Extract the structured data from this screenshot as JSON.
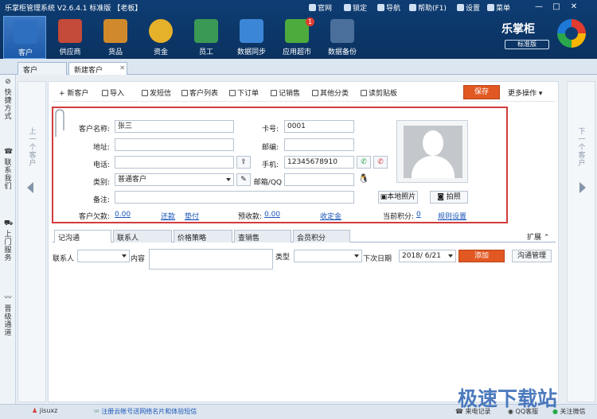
{
  "window": {
    "title": "乐掌柜管理系统 V2.6.4.1 标准版 【老板】",
    "links": [
      "官网",
      "锁定",
      "导航",
      "帮助(F1)",
      "设置",
      "菜单"
    ],
    "controls": [
      "—",
      "□",
      "✕"
    ]
  },
  "nav": {
    "items": [
      {
        "label": "客户",
        "color": "#2f6fc0"
      },
      {
        "label": "供应商",
        "color": "#c44a3a"
      },
      {
        "label": "货品",
        "color": "#d08a2c"
      },
      {
        "label": "资金",
        "color": "#e6b12a"
      },
      {
        "label": "员工",
        "color": "#3a9a55"
      },
      {
        "label": "数据同步",
        "color": "#3c86d8"
      },
      {
        "label": "应用超市",
        "color": "#4cab3c",
        "badge": "1"
      },
      {
        "label": "数据备份",
        "color": "#4a6f9a"
      }
    ]
  },
  "brand": {
    "name": "乐掌柜",
    "edition": "标准版"
  },
  "tabs": [
    "客户",
    "新建客户"
  ],
  "left_rail": {
    "items": [
      {
        "icon": "⊘",
        "label": "快捷方式"
      },
      {
        "icon": "☎",
        "label": "联系我们"
      },
      {
        "icon": "⛟",
        "label": "上门服务"
      },
      {
        "icon": "〰",
        "label": "晋级通道"
      }
    ]
  },
  "pager": {
    "prev": "上一个客户",
    "next": "下一个客户"
  },
  "toolbar": {
    "items": [
      "+ 新客户",
      "导入",
      "发短信",
      "客户列表",
      "下订单",
      "记销售",
      "其他分类",
      "读剪贴板"
    ],
    "save": "保存",
    "more": "更多操作"
  },
  "form": {
    "name_label": "客户名称:",
    "name_value": "张三",
    "card_label": "卡号:",
    "card_value": "0001",
    "address_label": "地址:",
    "zip_label": "邮编:",
    "phone_label": "电话:",
    "mobile_label": "手机:",
    "mobile_value": "12345678910",
    "category_label": "类别:",
    "category_value": "普通客户",
    "email_label": "邮箱/QQ",
    "note_label": "备注:",
    "debt_label": "客户欠款:",
    "debt_value": "0.00",
    "debt_action_1": "还款",
    "debt_action_2": "垫付",
    "prepay_label": "预收款:",
    "prepay_value": "0.00",
    "prepay_action": "收定金",
    "points_label": "当前积分:",
    "points_value": "0",
    "points_action": "规则设置",
    "local_photo": "本地照片",
    "take_photo": "拍照"
  },
  "subtabs": [
    "记沟通",
    "联系人",
    "价格策略",
    "查销售",
    "会员积分"
  ],
  "expand": "扩展",
  "comm": {
    "contact_label": "联系人",
    "content_label": "内容",
    "type_label": "类型",
    "next_date_label": "下次日期",
    "date_value": "2018/ 6/21",
    "add": "添加",
    "manage": "沟通管理"
  },
  "status": {
    "user": "jisuxz",
    "promo": "注册云帐号送网络名片和体验短信",
    "calls": "来电记录",
    "qq": "QQ客服",
    "wechat": "关注微信"
  },
  "watermark": "极速下载站"
}
